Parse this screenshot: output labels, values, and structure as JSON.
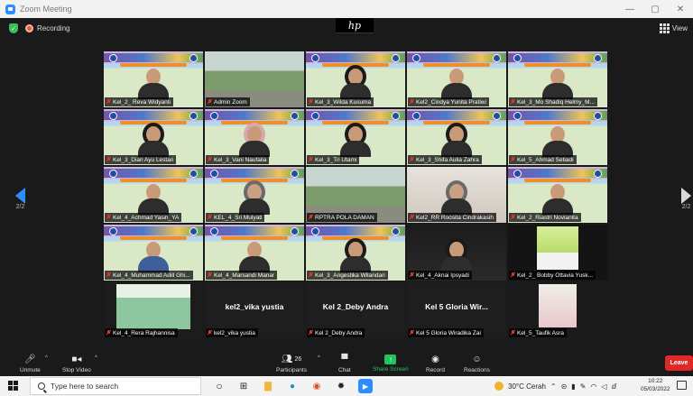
{
  "window": {
    "title": "Zoom Meeting",
    "controls": [
      "—",
      "▢",
      "✕"
    ]
  },
  "status": {
    "recording_label": "Recording",
    "view_label": "View"
  },
  "overlay": {
    "logo_text": "hp"
  },
  "pager": {
    "left_label": "2/2",
    "right_label": "2/2"
  },
  "participants": [
    {
      "name": "Kel_2_ Reva Widyanti",
      "style": "banner",
      "person": "default"
    },
    {
      "name": "Admin Zoom",
      "style": "outdoor",
      "person": "none"
    },
    {
      "name": "Kel_3_Wilda Kusuma",
      "style": "banner",
      "person": "hijab-black"
    },
    {
      "name": "Kel2_Cindya Yunita Pratiwi",
      "style": "banner",
      "person": "default"
    },
    {
      "name": "Kel_3_Mo Shadiq Helmy_M...",
      "style": "banner",
      "person": "default"
    },
    {
      "name": "Kel_3_Dian Ayu Lestari",
      "style": "banner",
      "person": "hijab-black"
    },
    {
      "name": "Kel_3_Vani Naufalia",
      "style": "banner",
      "person": "hijab-pink"
    },
    {
      "name": "Kel_3_Tri Utami",
      "style": "banner",
      "person": "hijab-black"
    },
    {
      "name": "Kel_3_Shifa Aulia Zahra",
      "style": "banner",
      "person": "hijab-black"
    },
    {
      "name": "Kel_5_Ahmad Setiadi",
      "style": "banner",
      "person": "default"
    },
    {
      "name": "Kel_4_Achmad Yasin_YA",
      "style": "banner",
      "person": "default"
    },
    {
      "name": "KEL_4_Sri Mulyati",
      "style": "banner",
      "person": "hijab"
    },
    {
      "name": "RPTRA POLA DAMAN",
      "style": "outdoor",
      "person": "none"
    },
    {
      "name": "Kel2_RR Roosita Cindrakasih",
      "style": "plain-light",
      "person": "hijab"
    },
    {
      "name": "Kel_2_Riastri Novianita",
      "style": "banner",
      "person": "default"
    },
    {
      "name": "Kel_4_Muhammad Adill Ghi...",
      "style": "banner",
      "person": "blue"
    },
    {
      "name": "Kel_4_Marsandi Manar",
      "style": "banner",
      "person": "default"
    },
    {
      "name": "Kel_3_Angestika Wilandari",
      "style": "banner",
      "person": "hijab-black"
    },
    {
      "name": "Kel_4_Aknai Ipsyadi",
      "style": "dark-room",
      "person": "hijab-black"
    },
    {
      "name": "Kel_2_ Bobby Ottavia Yusk...",
      "style": "greenbox",
      "person": "none"
    },
    {
      "name": "Kel_4_Rera Rajhannisa",
      "style": "map",
      "person": "none"
    },
    {
      "name": "kel2_vika yustia",
      "style": "textonly",
      "person": "none",
      "display": "kel2_vika yustia"
    },
    {
      "name": "Kel 2_Deby Andra",
      "style": "textonly",
      "person": "none",
      "display": "Kel 2_Deby Andra"
    },
    {
      "name": "Kel 5 Gloria Wiradika Zai",
      "style": "textonly",
      "person": "none",
      "display": "Kel 5 Gloria Wir..."
    },
    {
      "name": "Kel_5_Taufik Asra",
      "style": "pic",
      "person": "none"
    }
  ],
  "toolbar": {
    "unmute": "Unmute",
    "stop_video": "Stop Video",
    "participants": "Participants",
    "participants_count": "26",
    "chat": "Chat",
    "share": "Share Screen",
    "record": "Record",
    "reactions": "Reactions",
    "leave": "Leave"
  },
  "taskbar": {
    "search_placeholder": "Type here to search",
    "weather": "30°C Cerah",
    "time": "10:22",
    "date": "05/03/2022"
  },
  "colors": {
    "accent": "#2d8cff",
    "share": "#23c45e",
    "leave": "#e02828",
    "muted": "#e0342b"
  }
}
